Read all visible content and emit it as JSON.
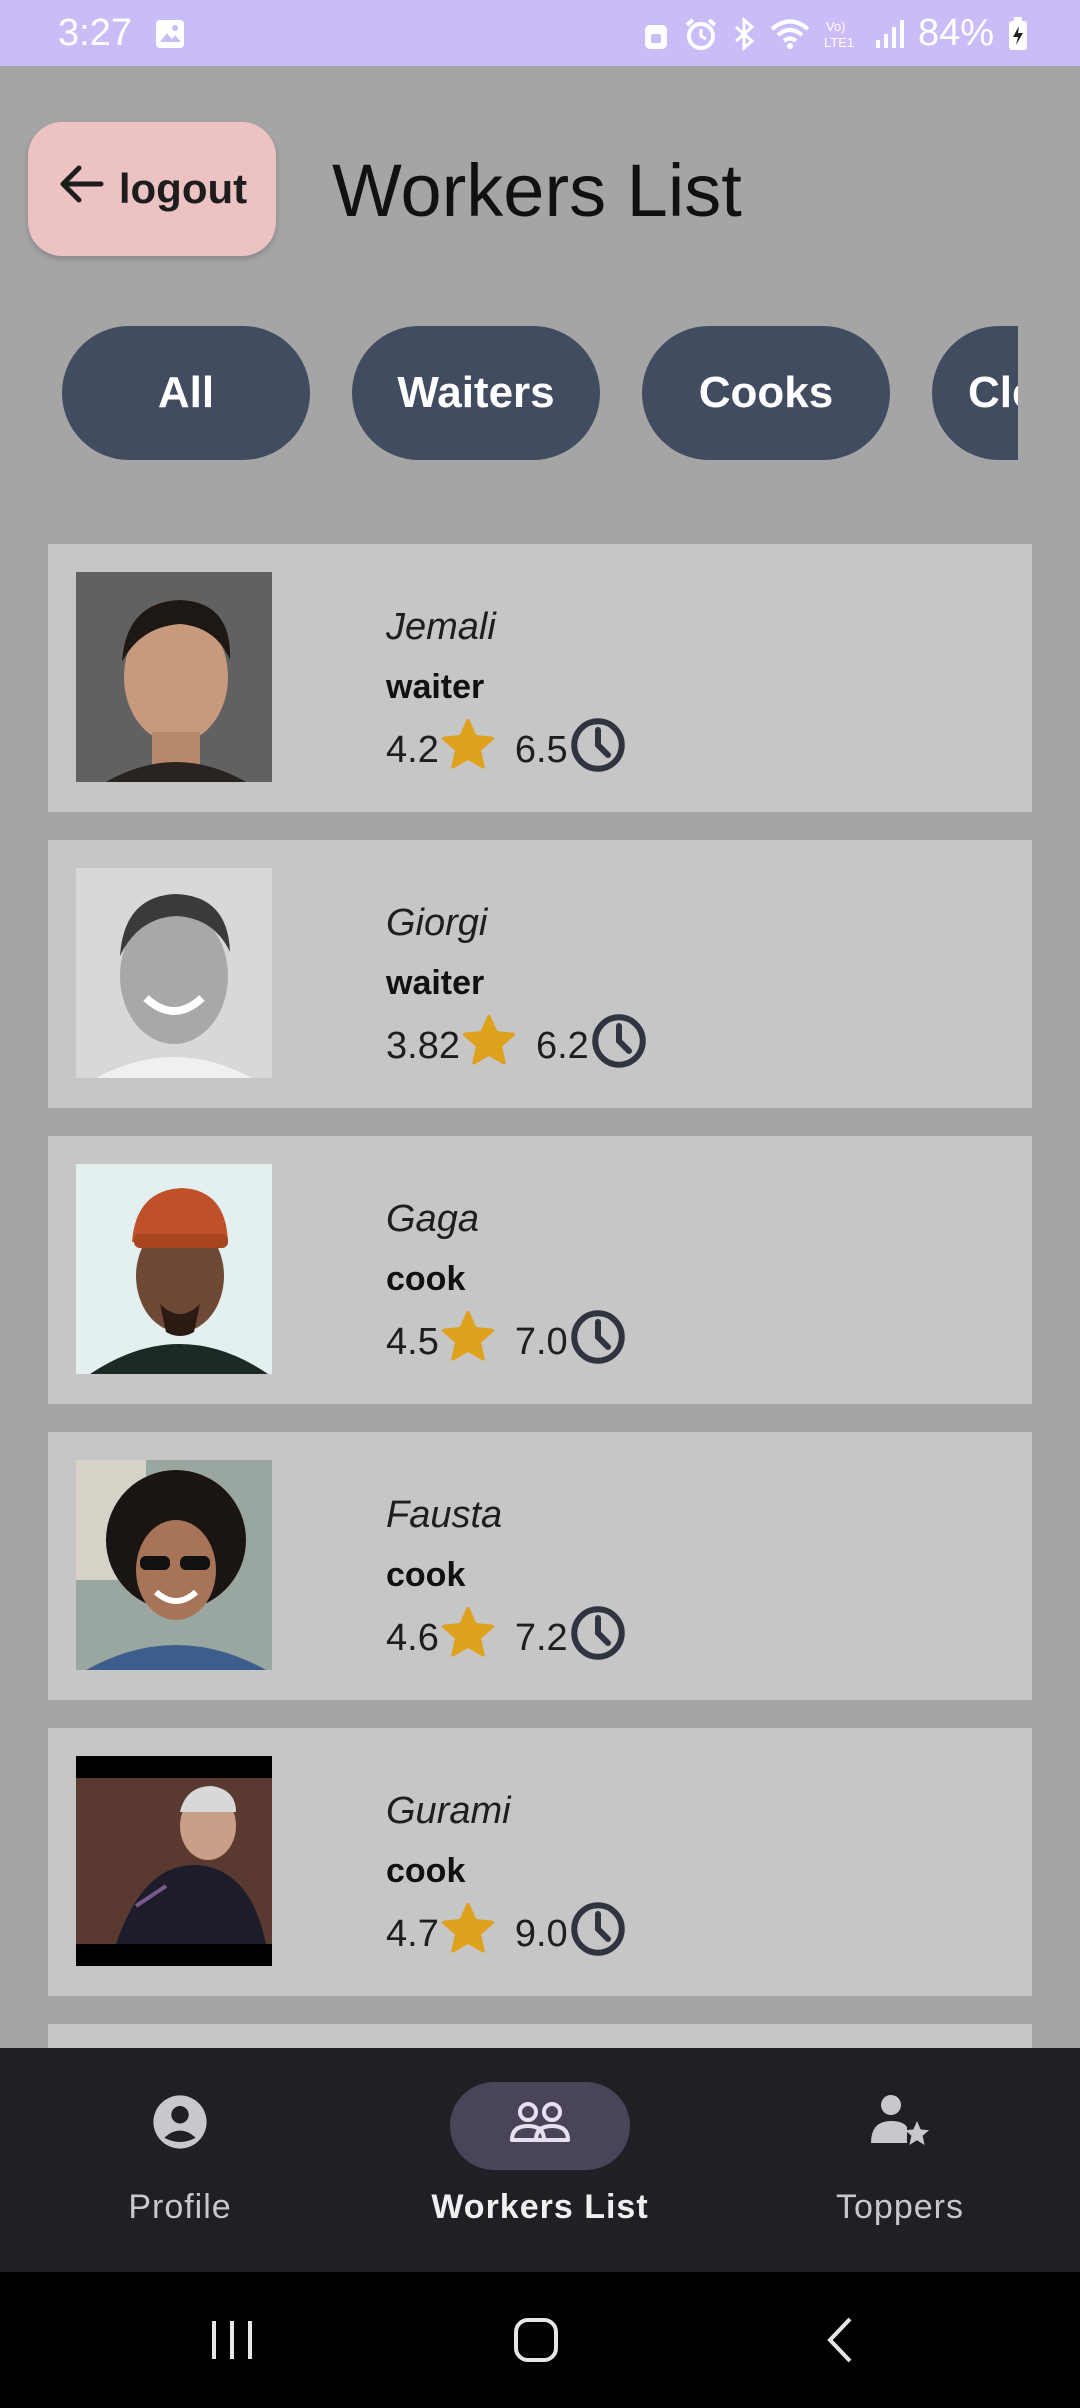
{
  "status_bar": {
    "time": "3:27",
    "battery": "84%"
  },
  "header": {
    "logout_label": "logout",
    "title": "Workers List"
  },
  "filters": [
    {
      "label": "All"
    },
    {
      "label": "Waiters"
    },
    {
      "label": "Cooks"
    },
    {
      "label": "Cleaners"
    }
  ],
  "workers": [
    {
      "name": "Jemali",
      "role": "waiter",
      "rating": "4.2",
      "hours": "6.5"
    },
    {
      "name": "Giorgi",
      "role": "waiter",
      "rating": "3.82",
      "hours": "6.2"
    },
    {
      "name": "Gaga",
      "role": "cook",
      "rating": "4.5",
      "hours": "7.0"
    },
    {
      "name": "Fausta",
      "role": "cook",
      "rating": "4.6",
      "hours": "7.2"
    },
    {
      "name": "Gurami",
      "role": "cook",
      "rating": "4.7",
      "hours": "9.0"
    }
  ],
  "bottom_nav": [
    {
      "label": "Profile",
      "icon": "profile-icon",
      "active": false
    },
    {
      "label": "Workers List",
      "icon": "group-icon",
      "active": true
    },
    {
      "label": "Toppers",
      "icon": "user-star-icon",
      "active": false
    }
  ],
  "colors": {
    "status_bar": "#cabdf7",
    "background": "#a5a5a5",
    "card": "#c6c6c6",
    "chip": "#414c60",
    "logout": "#ecc2c2",
    "star": "#dea11c",
    "nav_bg": "#1f1f25"
  }
}
